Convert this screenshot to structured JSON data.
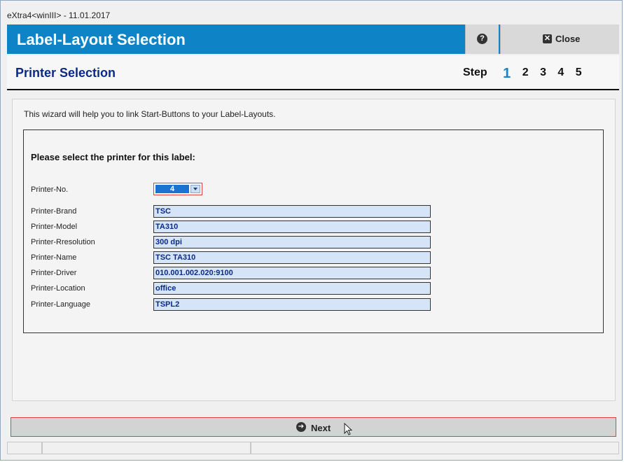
{
  "window": {
    "title": "eXtra4<winIII>  -  11.01.2017"
  },
  "header": {
    "title": "Label-Layout Selection",
    "help_icon": "question-circle-icon",
    "close_label": "Close",
    "close_icon": "close-x-icon"
  },
  "subheader": {
    "title": "Printer Selection",
    "step_label": "Step",
    "steps": [
      "1",
      "2",
      "3",
      "4",
      "5"
    ],
    "current_step": "1"
  },
  "content": {
    "intro": "This wizard will help you to link Start-Buttons to your Label-Layouts.",
    "prompt": "Please select the printer for this label:",
    "printer_no_label": "Printer-No.",
    "printer_no_value": "4",
    "fields": [
      {
        "label": "Printer-Brand",
        "value": "TSC"
      },
      {
        "label": "Printer-Model",
        "value": "TA310"
      },
      {
        "label": "Printer-Rresolution",
        "value": "300 dpi"
      },
      {
        "label": "Printer-Name",
        "value": "TSC TA310"
      },
      {
        "label": "Printer-Driver",
        "value": "010.001.002.020:9100"
      },
      {
        "label": "Printer-Location",
        "value": "office"
      },
      {
        "label": "Printer-Language",
        "value": "TSPL2"
      }
    ]
  },
  "footer": {
    "next_label": "Next",
    "next_icon": "arrow-right-circle-icon"
  },
  "colors": {
    "header_bg": "#0e84c7",
    "title_text": "#0b2a86",
    "field_bg": "#d5e5f7",
    "highlight_border": "#e04040"
  }
}
